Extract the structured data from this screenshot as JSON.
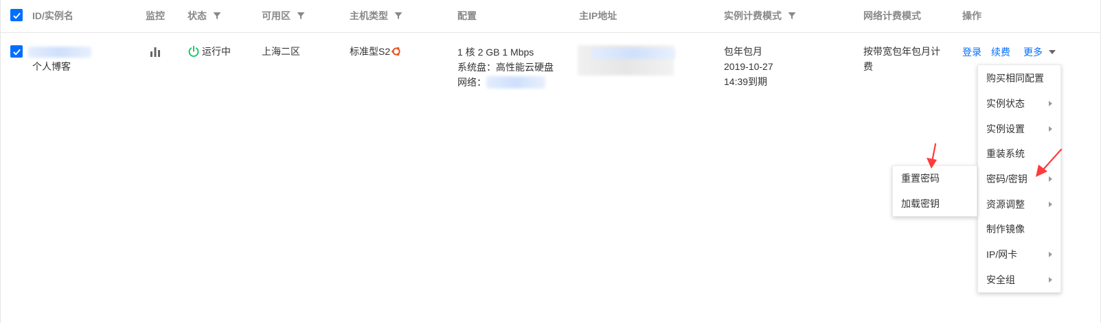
{
  "header": {
    "columns": [
      {
        "label": "ID/实例名",
        "filter": false
      },
      {
        "label": "监控",
        "filter": false
      },
      {
        "label": "状态",
        "filter": true
      },
      {
        "label": "可用区",
        "filter": true
      },
      {
        "label": "主机类型",
        "filter": true
      },
      {
        "label": "配置",
        "filter": false
      },
      {
        "label": "主IP地址",
        "filter": false
      },
      {
        "label": "实例计费模式",
        "filter": true
      },
      {
        "label": "网络计费模式",
        "filter": false
      },
      {
        "label": "操作",
        "filter": false
      }
    ]
  },
  "row": {
    "instance_name": "个人博客",
    "status": "运行中",
    "zone": "上海二区",
    "host_type": "标准型S2",
    "config": {
      "line1": "1 核 2 GB 1 Mbps",
      "line2": "系统盘：高性能云硬盘",
      "line3_label": "网络："
    },
    "billing": {
      "line1": "包年包月",
      "line2": "2019-10-27",
      "line3": "14:39到期"
    },
    "network_billing": {
      "line1": "按带宽包年包月计",
      "line2": "费"
    },
    "actions": {
      "login": "登录",
      "renew": "续费",
      "more": "更多"
    }
  },
  "more_menu": {
    "items": [
      {
        "label": "购买相同配置",
        "has_submenu": false
      },
      {
        "label": "实例状态",
        "has_submenu": true
      },
      {
        "label": "实例设置",
        "has_submenu": true
      },
      {
        "label": "重装系统",
        "has_submenu": false
      },
      {
        "label": "密码/密钥",
        "has_submenu": true
      },
      {
        "label": "资源调整",
        "has_submenu": true
      },
      {
        "label": "制作镜像",
        "has_submenu": false
      },
      {
        "label": "IP/网卡",
        "has_submenu": true
      },
      {
        "label": "安全组",
        "has_submenu": true
      }
    ]
  },
  "password_submenu": {
    "items": [
      {
        "label": "重置密码"
      },
      {
        "label": "加载密钥"
      }
    ]
  },
  "colors": {
    "accent": "#006eff",
    "running": "#0abf5b",
    "ubuntu": "#e95420",
    "annotation": "#ff3b3b"
  }
}
